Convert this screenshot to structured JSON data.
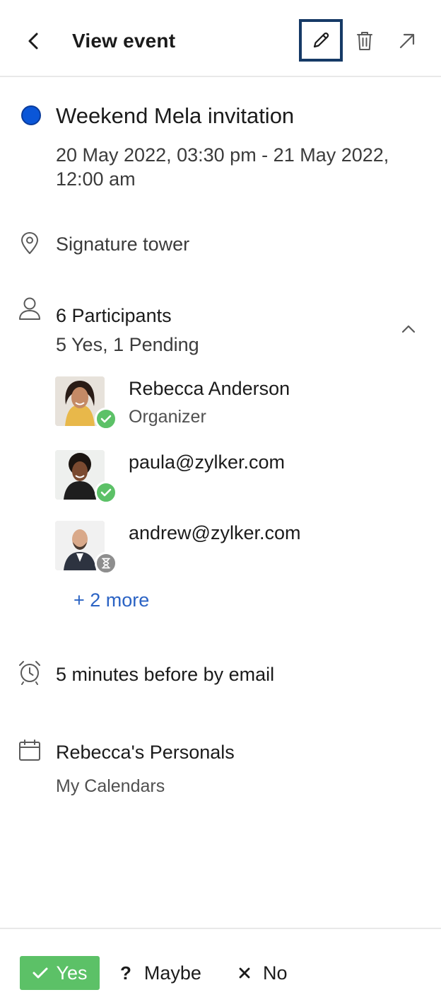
{
  "header": {
    "title": "View event",
    "back_icon": "chevron-left-icon",
    "edit_icon": "pencil-icon",
    "delete_icon": "trash-icon",
    "open_icon": "arrow-up-right-icon"
  },
  "event": {
    "color": "#0a56d8",
    "title": "Weekend Mela invitation",
    "time": "20 May 2022, 03:30 pm - 21 May 2022, 12:00 am"
  },
  "location": {
    "icon": "map-pin-icon",
    "text": "Signature tower"
  },
  "participants": {
    "icon": "person-icon",
    "count_label": "6 Participants",
    "summary": "5 Yes, 1 Pending",
    "collapse_icon": "chevron-up-icon",
    "list": [
      {
        "name": "Rebecca Anderson",
        "role": "Organizer",
        "status": "yes"
      },
      {
        "name": "paula@zylker.com",
        "role": "",
        "status": "yes"
      },
      {
        "name": "andrew@zylker.com",
        "role": "",
        "status": "pending"
      }
    ],
    "more_label": "+ 2 more"
  },
  "reminder": {
    "icon": "alarm-clock-icon",
    "text": "5 minutes before by email"
  },
  "calendar": {
    "icon": "calendar-icon",
    "name": "Rebecca's Personals",
    "group": "My Calendars"
  },
  "rsvp": {
    "yes_label": "Yes",
    "maybe_label": "Maybe",
    "no_label": "No",
    "yes_color": "#5cc167"
  },
  "colors": {
    "accent_link": "#2b63c4",
    "focus_border": "#163a66",
    "status_yes": "#5cc167",
    "status_pending": "#8e8e8e"
  }
}
